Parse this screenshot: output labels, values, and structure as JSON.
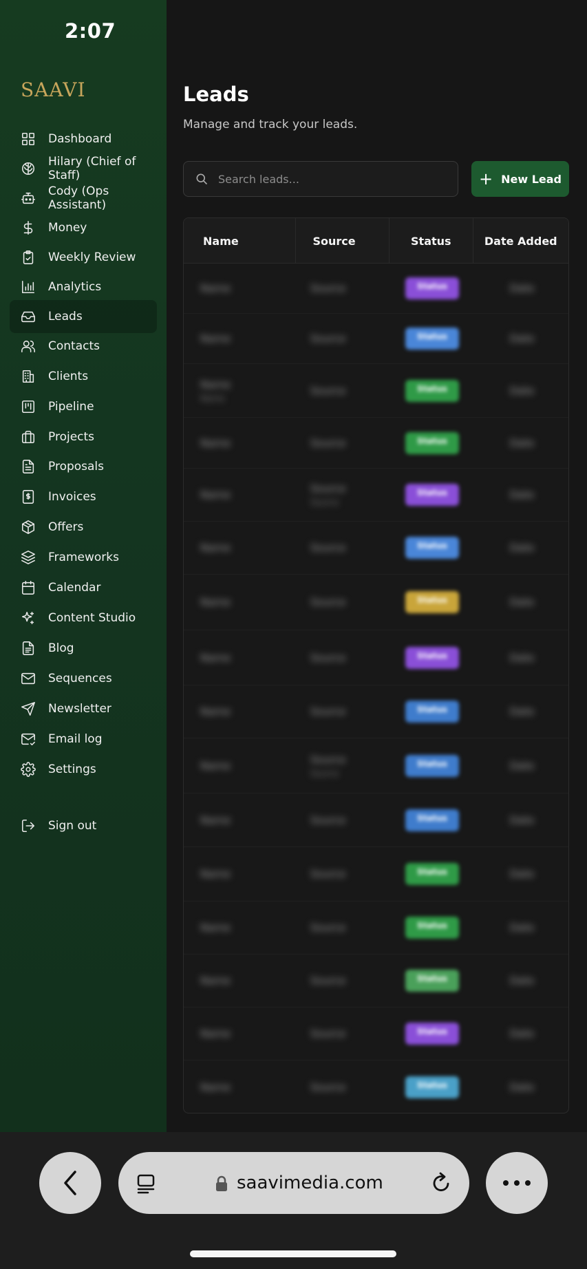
{
  "status_bar": {
    "time": "2:07"
  },
  "brand": {
    "logo_text": "SAAVI",
    "accent": "#c7a55b",
    "sidebar_bg": "#163b20",
    "primary_button": "#1d5a2f"
  },
  "sidebar": {
    "items": [
      {
        "label": "Dashboard",
        "icon": "grid-icon"
      },
      {
        "label": "Hilary (Chief of Staff)",
        "icon": "brain-icon"
      },
      {
        "label": "Cody (Ops Assistant)",
        "icon": "bot-icon"
      },
      {
        "label": "Money",
        "icon": "dollar-icon"
      },
      {
        "label": "Weekly Review",
        "icon": "clipboard-check-icon"
      },
      {
        "label": "Analytics",
        "icon": "bar-chart-icon"
      },
      {
        "label": "Leads",
        "icon": "inbox-icon",
        "active": true
      },
      {
        "label": "Contacts",
        "icon": "users-icon"
      },
      {
        "label": "Clients",
        "icon": "building-icon"
      },
      {
        "label": "Pipeline",
        "icon": "kanban-icon"
      },
      {
        "label": "Projects",
        "icon": "briefcase-icon"
      },
      {
        "label": "Proposals",
        "icon": "file-text-icon"
      },
      {
        "label": "Invoices",
        "icon": "receipt-icon"
      },
      {
        "label": "Offers",
        "icon": "package-icon"
      },
      {
        "label": "Frameworks",
        "icon": "layers-icon"
      },
      {
        "label": "Calendar",
        "icon": "calendar-icon"
      },
      {
        "label": "Content Studio",
        "icon": "sparkles-icon"
      },
      {
        "label": "Blog",
        "icon": "document-icon"
      },
      {
        "label": "Sequences",
        "icon": "mail-icon"
      },
      {
        "label": "Newsletter",
        "icon": "send-icon"
      },
      {
        "label": "Email log",
        "icon": "mail-check-icon"
      },
      {
        "label": "Settings",
        "icon": "gear-icon"
      }
    ],
    "sign_out": "Sign out"
  },
  "main": {
    "title": "Leads",
    "subtitle": "Manage and track your leads.",
    "search_placeholder": "Search leads...",
    "new_lead_label": "New Lead",
    "columns": [
      "Name",
      "Source",
      "Status",
      "Date Added"
    ],
    "rows": [
      {
        "name": "Name",
        "source": "Source",
        "status": "Status",
        "date": "Date",
        "color": "#8a4fd8"
      },
      {
        "name": "Name",
        "source": "Source",
        "status": "Status",
        "date": "Date",
        "color": "#4a86d8"
      },
      {
        "name": "Name",
        "name2": "Name",
        "source": "Source",
        "status": "Status",
        "date": "Date",
        "color": "#2f9a47"
      },
      {
        "name": "Name",
        "source": "Source",
        "status": "Status",
        "date": "Date",
        "color": "#2f9a47"
      },
      {
        "name": "Name",
        "source": "Source",
        "source2": "Source",
        "status": "Status",
        "date": "Date",
        "color": "#8a4fd8"
      },
      {
        "name": "Name",
        "source": "Source",
        "status": "Status",
        "date": "Date",
        "color": "#4a86d8"
      },
      {
        "name": "Name",
        "source": "Source",
        "status": "Status",
        "date": "Date",
        "color": "#c9a53a"
      },
      {
        "name": "Name",
        "source": "Source",
        "status": "Status",
        "date": "Date",
        "color": "#8a4fd8"
      },
      {
        "name": "Name",
        "source": "Source",
        "status": "Status",
        "date": "Date",
        "color": "#3f7ccc"
      },
      {
        "name": "Name",
        "source": "Source",
        "source2": "Source",
        "status": "Status",
        "date": "Date",
        "color": "#3f7ccc"
      },
      {
        "name": "Name",
        "source": "Source",
        "status": "Status",
        "date": "Date",
        "color": "#3f7ccc"
      },
      {
        "name": "Name",
        "source": "Source",
        "status": "Status",
        "date": "Date",
        "color": "#2f9a47"
      },
      {
        "name": "Name",
        "source": "Source",
        "status": "Status",
        "date": "Date",
        "color": "#2f9a47"
      },
      {
        "name": "Name",
        "source": "Source",
        "status": "Status",
        "date": "Date",
        "color": "#4aa05a"
      },
      {
        "name": "Name",
        "source": "Source",
        "status": "Status",
        "date": "Date",
        "color": "#8a4fd8"
      },
      {
        "name": "Name",
        "source": "Source",
        "status": "Status",
        "date": "Date",
        "color": "#4aa0c8"
      }
    ]
  },
  "browser": {
    "url": "saavimedia.com"
  }
}
